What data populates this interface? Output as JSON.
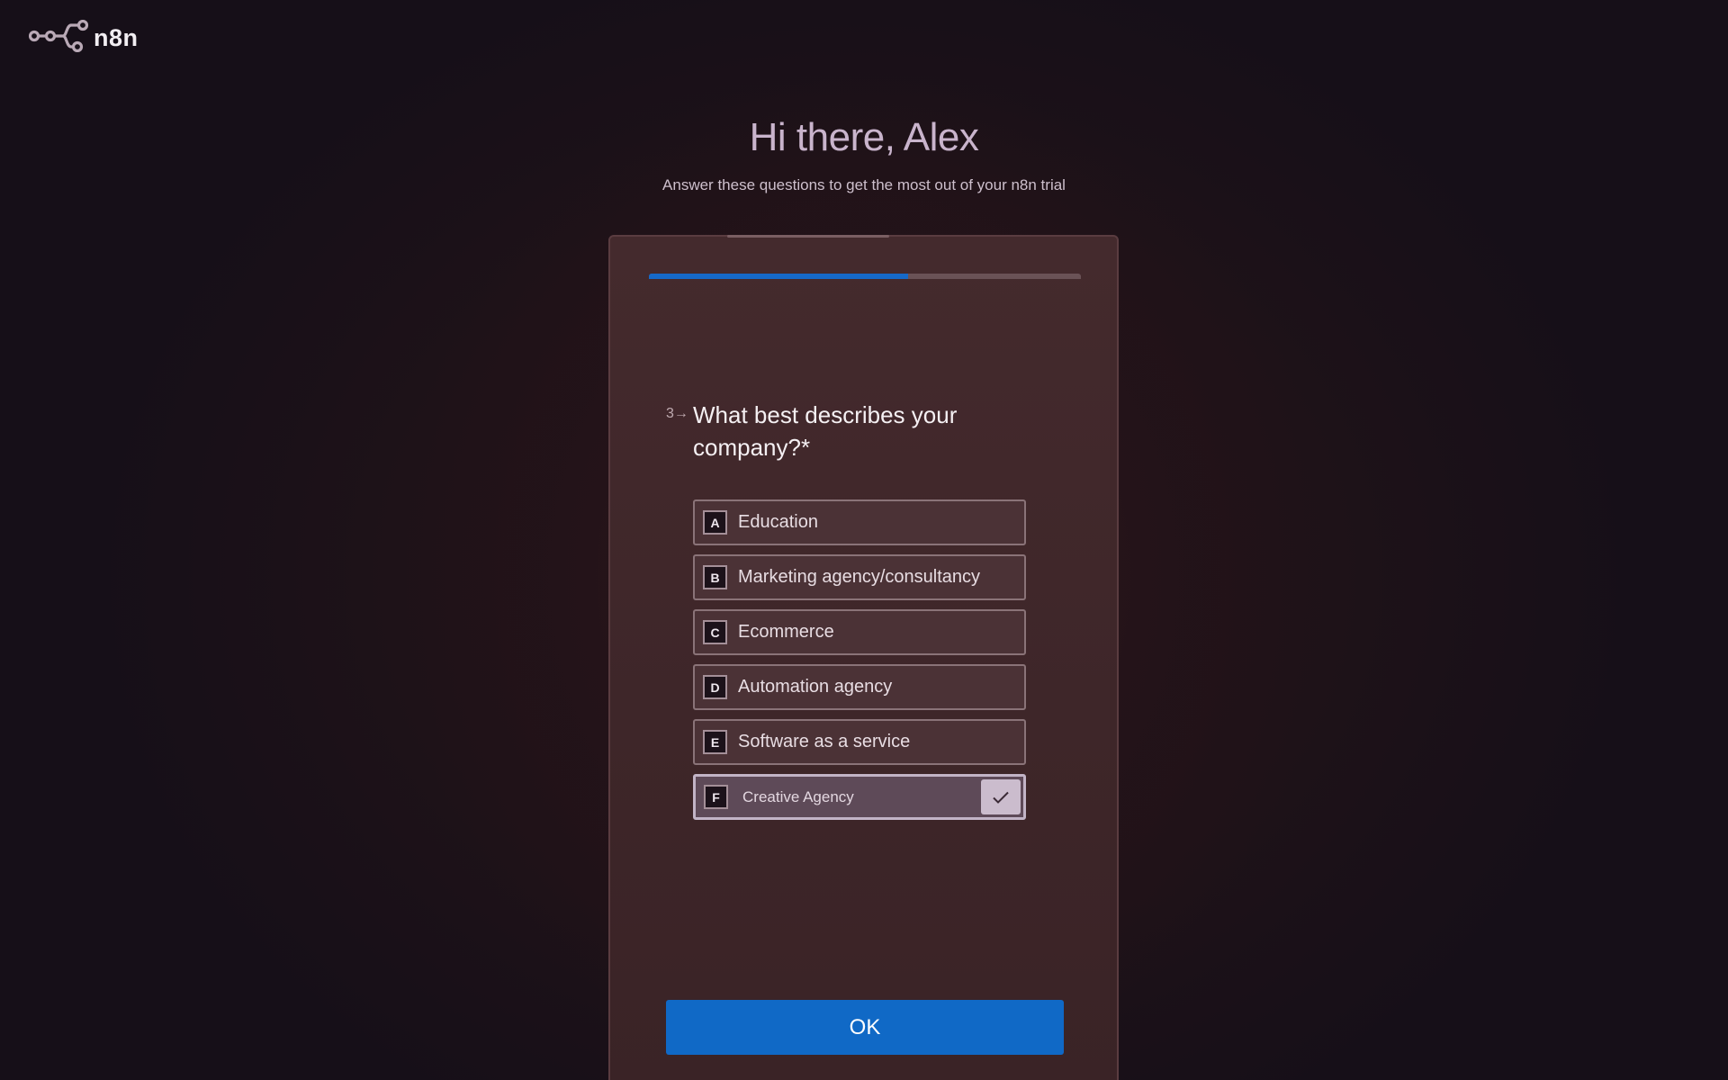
{
  "app": {
    "logo_text": "n8n",
    "logo_icon": "n8n-nodes-icon"
  },
  "header": {
    "greeting": "Hi there, Alex",
    "subtitle": "Answer these questions to get the most out of your n8n trial"
  },
  "survey": {
    "progress_fraction": 0.6,
    "question_number": "3→",
    "question": "What best describes your company?*",
    "options": [
      {
        "key": "A",
        "label": "Education",
        "selected": false
      },
      {
        "key": "B",
        "label": "Marketing agency/consultancy",
        "selected": false
      },
      {
        "key": "C",
        "label": "Ecommerce",
        "selected": false
      },
      {
        "key": "D",
        "label": "Automation agency",
        "selected": false
      },
      {
        "key": "E",
        "label": "Software as a service",
        "selected": false
      },
      {
        "key": "F",
        "label": "Creative Agency",
        "selected": true
      }
    ],
    "selected_icon": "checkmark-icon",
    "ok_label": "OK"
  },
  "colors": {
    "accent": "#1069c6",
    "background": "#160f18",
    "card": "#442a2d"
  }
}
